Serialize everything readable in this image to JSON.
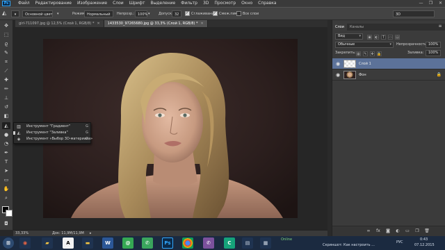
{
  "app": {
    "menu": [
      "Файл",
      "Редактирование",
      "Изображение",
      "Слои",
      "Шрифт",
      "Выделение",
      "Фильтр",
      "3D",
      "Просмотр",
      "Окно",
      "Справка"
    ],
    "logo": "Ps"
  },
  "options": {
    "preset_label": "Основной цвет",
    "mode_label": "Режим:",
    "mode_value": "Нормальный",
    "opacity_label": "Непрозр.:",
    "opacity_value": "100%",
    "tolerance_label": "Допуск:",
    "tolerance_value": "32",
    "antialias_label": "Сглаживание",
    "contiguous_label": "Смеж.пикс",
    "all_layers_label": "Все слои",
    "workspace_value": "3D"
  },
  "tabs": [
    {
      "label": "girl-711097.jpg @ 12,5% (Слой 1, RGB/8) *",
      "active": false
    },
    {
      "label": "1433530_97265680.jpg @ 33,3% (Слой 1, RGB/8) *",
      "active": true
    }
  ],
  "flyout": [
    {
      "icon": "gradient-icon",
      "label": "Инструмент \"Градиент\"",
      "key": "G",
      "selected": false
    },
    {
      "icon": "paint-bucket-icon",
      "label": "Инструмент \"Заливка\"",
      "key": "G",
      "selected": true
    },
    {
      "icon": "3d-material-drop-icon",
      "label": "Инструмент «Выбор 3D-материала»",
      "key": "G",
      "selected": false
    }
  ],
  "status": {
    "zoom": "33,33%",
    "doc": "Док: 11,9M/11,9M"
  },
  "layers_panel": {
    "tabs": [
      "Слои",
      "Каналы"
    ],
    "filter_value": "Вид",
    "blend_value": "Обычные",
    "opacity_label": "Непрозрачность:",
    "opacity_value": "100%",
    "lock_label": "Закрепить:",
    "fill_label": "Заливка:",
    "fill_value": "100%",
    "layers": [
      {
        "name": "Слой 1",
        "active": true
      },
      {
        "name": "Фон",
        "active": false
      }
    ]
  },
  "taskbar": {
    "tray": {
      "line1": "Online",
      "line2": "Скриншот: Как настроить ...",
      "time": "0:43",
      "date": "07.12.2015",
      "lang": "РУС"
    }
  },
  "colors": {
    "menubar": "#3a3a3a",
    "options": "#434343",
    "panel": "#3b3b3b",
    "active_layer": "#5c7299",
    "taskbar": "#1b2a40"
  }
}
